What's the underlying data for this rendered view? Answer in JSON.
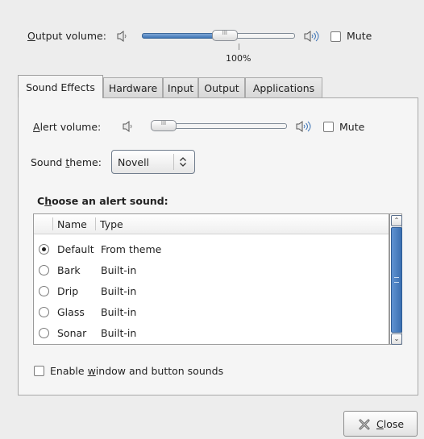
{
  "output": {
    "label_prefix": "",
    "label_accel": "O",
    "label_rest": "utput volume:",
    "level_percent": 55,
    "percent_text": "100%",
    "mute_label": "Mute",
    "mute_checked": false
  },
  "tabs": [
    {
      "label": "Sound Effects",
      "active": true
    },
    {
      "label": "Hardware",
      "active": false
    },
    {
      "label": "Input",
      "active": false
    },
    {
      "label": "Output",
      "active": false
    },
    {
      "label": "Applications",
      "active": false
    }
  ],
  "alert": {
    "label_accel": "A",
    "label_rest": "lert volume:",
    "level_percent": 0,
    "mute_label": "Mute",
    "mute_checked": false
  },
  "theme": {
    "label_prefix": "Sound ",
    "label_accel": "t",
    "label_rest": "heme:",
    "value": "Novell"
  },
  "choose": {
    "label_prefix": "C",
    "label_accel": "h",
    "label_rest": "oose an alert sound:"
  },
  "sounds": {
    "columns": [
      "Name",
      "Type"
    ],
    "rows": [
      {
        "name": "Default",
        "type": "From theme",
        "selected": true
      },
      {
        "name": "Bark",
        "type": "Built-in",
        "selected": false
      },
      {
        "name": "Drip",
        "type": "Built-in",
        "selected": false
      },
      {
        "name": "Glass",
        "type": "Built-in",
        "selected": false
      },
      {
        "name": "Sonar",
        "type": "Built-in",
        "selected": false
      }
    ]
  },
  "enable_sounds": {
    "label_prefix": "Enable ",
    "label_accel": "w",
    "label_rest": "indow and button sounds",
    "checked": false
  },
  "close_button": {
    "label_accel": "C",
    "label_rest": "lose"
  },
  "icons": {
    "speaker_low": "speaker-low-icon",
    "speaker_high": "speaker-high-icon",
    "close": "close-x-icon",
    "spinner": "combo-arrows-icon"
  }
}
